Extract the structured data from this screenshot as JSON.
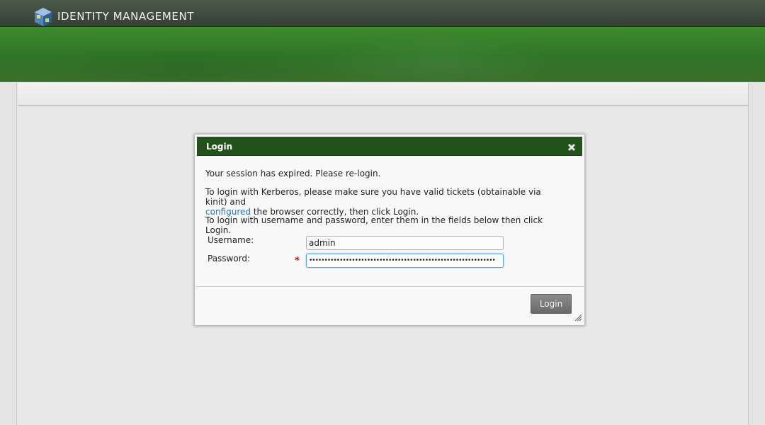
{
  "app": {
    "brand": "IDENTITY MANAGEMENT"
  },
  "dialog": {
    "title": "Login",
    "messages": {
      "session_expired": "Your session has expired. Please re-login.",
      "kerberos_prefix": "To login with Kerberos, please make sure you have valid tickets (obtainable via kinit) and",
      "kerberos_link": "configured",
      "kerberos_suffix": " the browser correctly, then click Login.",
      "userpass": "To login with username and password, enter them in the fields below then click Login."
    },
    "fields": {
      "username_label": "Username:",
      "username_value": "admin",
      "password_label": "Password:",
      "password_value": "•••••••••••••••••••••••••••••••••••••••••••••••••••••••••••••",
      "required_marker": "*"
    },
    "login_button": "Login"
  },
  "colors": {
    "header": "#354035",
    "banner": "#2f7427",
    "dialog_title": "#22531b",
    "link": "#2a72b5",
    "required": "#d40000"
  },
  "icons": {
    "logo": "cube-logo-icon",
    "close": "close-icon",
    "resize": "resize-grip-icon"
  }
}
